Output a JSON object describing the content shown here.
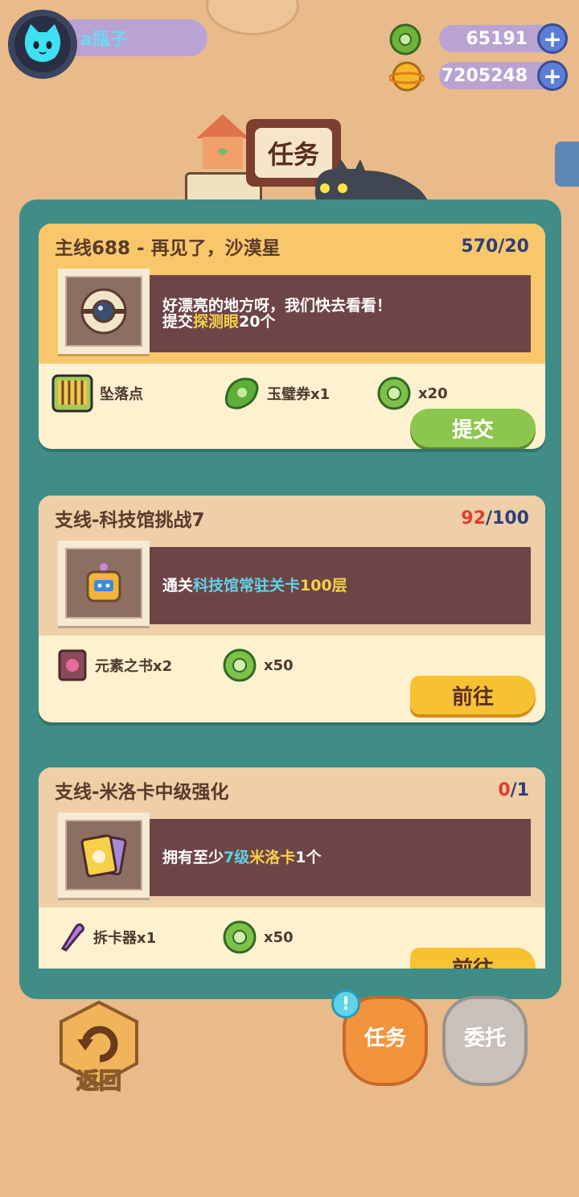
{
  "user": {
    "name": "a瓶子"
  },
  "currency": {
    "jade": {
      "amount": "65191",
      "icon": "jade-coin-icon"
    },
    "gold": {
      "amount": "7205248",
      "icon": "planet-coin-icon"
    }
  },
  "page_title": "任务",
  "tasks": [
    {
      "title": "主线688 - 再见了，沙漠星",
      "progress_current": "570",
      "progress_sep": "/",
      "progress_total": "20",
      "desc_line1": "好漂亮的地方呀，我们快去看看！",
      "desc_line2_a": "提交",
      "desc_line2_hl": "探测眼",
      "desc_line2_b": "20个",
      "rewards": [
        {
          "label": "坠落点",
          "icon": "cage-icon"
        },
        {
          "label": "玉璧券x1",
          "icon": "jade-ticket-icon"
        },
        {
          "label": "x20",
          "icon": "jade-coin-icon"
        }
      ],
      "button": "提交"
    },
    {
      "title": "支线-科技馆挑战7",
      "progress_current": "92",
      "progress_sep": "/",
      "progress_total": "100",
      "desc_a": "通关",
      "desc_hl": "科技馆常驻关卡",
      "desc_num": "100层",
      "rewards": [
        {
          "label": "元素之书x2",
          "icon": "element-book-icon"
        },
        {
          "label": "x50",
          "icon": "jade-coin-icon"
        }
      ],
      "button": "前往"
    },
    {
      "title": "支线-米洛卡中级强化",
      "progress_current": "0",
      "progress_sep": "/",
      "progress_total": "1",
      "desc_a": "拥有至少",
      "desc_num": "7级",
      "desc_hl": "米洛卡",
      "desc_b": "1个",
      "rewards": [
        {
          "label": "拆卡器x1",
          "icon": "card-remover-icon"
        },
        {
          "label": "x50",
          "icon": "jade-coin-icon"
        }
      ],
      "button": "前往"
    }
  ],
  "bottom": {
    "back_label": "返回",
    "tab_tasks": "任务",
    "tab_commission": "委托",
    "notice_badge": "!"
  },
  "colors": {
    "background": "#e9bb8a",
    "panel": "#3f8d86",
    "main_header": "#f9c76b",
    "side_header": "#efcfa8",
    "desc_box": "#6d4546",
    "highlight_yellow": "#f5d04b",
    "highlight_cyan": "#5fd3e8",
    "progress_red": "#e23b2e",
    "progress_navy": "#2f3e7a",
    "submit_green": "#8cc64e",
    "goto_yellow": "#f7c232"
  }
}
